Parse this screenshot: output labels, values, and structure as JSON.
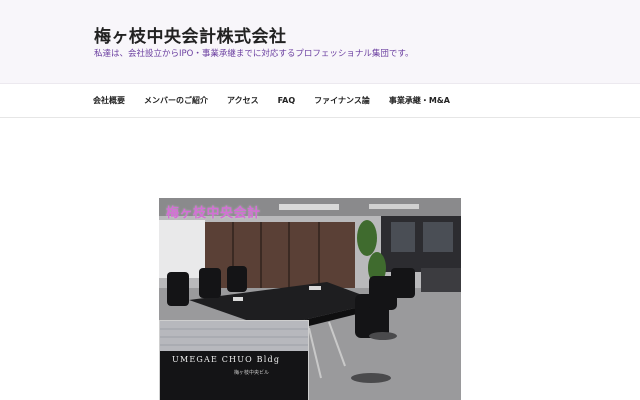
{
  "header": {
    "title": "梅ヶ枝中央会計株式会社",
    "tagline": "私達は、会社設立からIPO・事業承継までに対応するプロフェッショナル集団です。"
  },
  "nav": {
    "items": [
      {
        "label": "会社概要"
      },
      {
        "label": "メンバーのご紹介"
      },
      {
        "label": "アクセス"
      },
      {
        "label": "FAQ"
      },
      {
        "label": "ファイナンス論"
      },
      {
        "label": "事業承継・M&A"
      }
    ]
  },
  "hero": {
    "caption": "梅ヶ枝中央会計",
    "inset_sign": "UMEGAE CHUO Bldg",
    "inset_sub": "梅ヶ枝中央ビル"
  },
  "colors": {
    "header_bg": "#f8f6fa",
    "tagline": "#6b3fa0",
    "caption": "#d46fd6"
  }
}
